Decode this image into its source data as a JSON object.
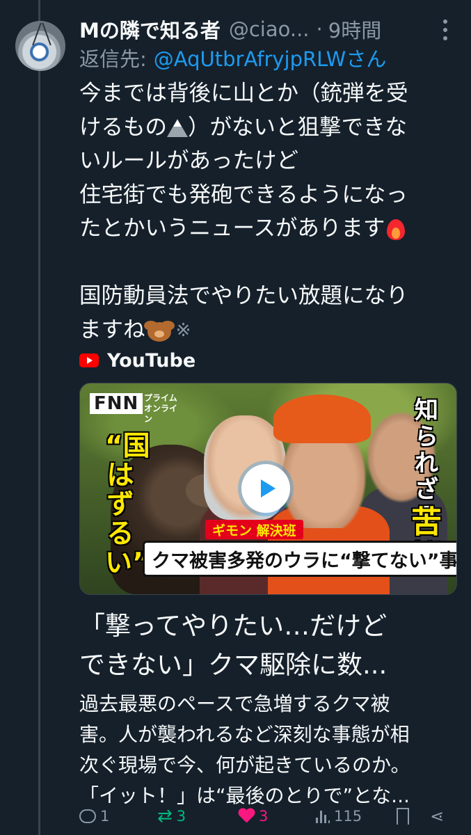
{
  "tweet": {
    "display_name": "Mの隣で知る者",
    "handle": "@ciao...",
    "time": "9時間",
    "reply_prefix": "返信先:",
    "reply_to": "@AqUtbrAfryjpRLWさん",
    "text_lines": [
      "今までは背後に山とか（銃弾を受",
      "けるもの",
      "）がないと狙撃できな",
      "いルールがあったけど",
      "住宅街でも発砲できるようになっ",
      "たとかいうニュースがあります",
      "国防動員法でやりたい放題になり",
      "ますね"
    ],
    "emojis": [
      "mountain-emoji",
      "fire-emoji",
      "bear-emoji",
      "anger-emoji"
    ]
  },
  "card": {
    "source": "YouTube",
    "thumbnail": {
      "logo": "FNN",
      "logo_sub": "プライム オンライン",
      "left_caption": "“国はずるい”",
      "right_caption_top": "知られざる",
      "right_caption_bottom": "苦悩",
      "banner": "ギモン 解決班",
      "headline": "クマ被害多発のウラに“撃てない”事情"
    },
    "title_lines": [
      "「撃ってやりたい…だけど",
      "できない」クマ駆除に数..."
    ],
    "description_lines": [
      "過去最悪のペースで急増するクマ被",
      "害。人が襲われるなど深刻な事態が相",
      "次ぐ現場で今、何が起きているのか。",
      "「イット！」は“最後のとりで”とな..."
    ]
  },
  "actions": {
    "replies": "1",
    "reposts": "3",
    "likes": "3",
    "views": "115"
  },
  "colors": {
    "background": "#15202b",
    "text": "#f7f9f9",
    "muted": "#8b98a5",
    "link": "#1d9bf0",
    "repost": "#00ba7c",
    "like": "#f91880"
  }
}
